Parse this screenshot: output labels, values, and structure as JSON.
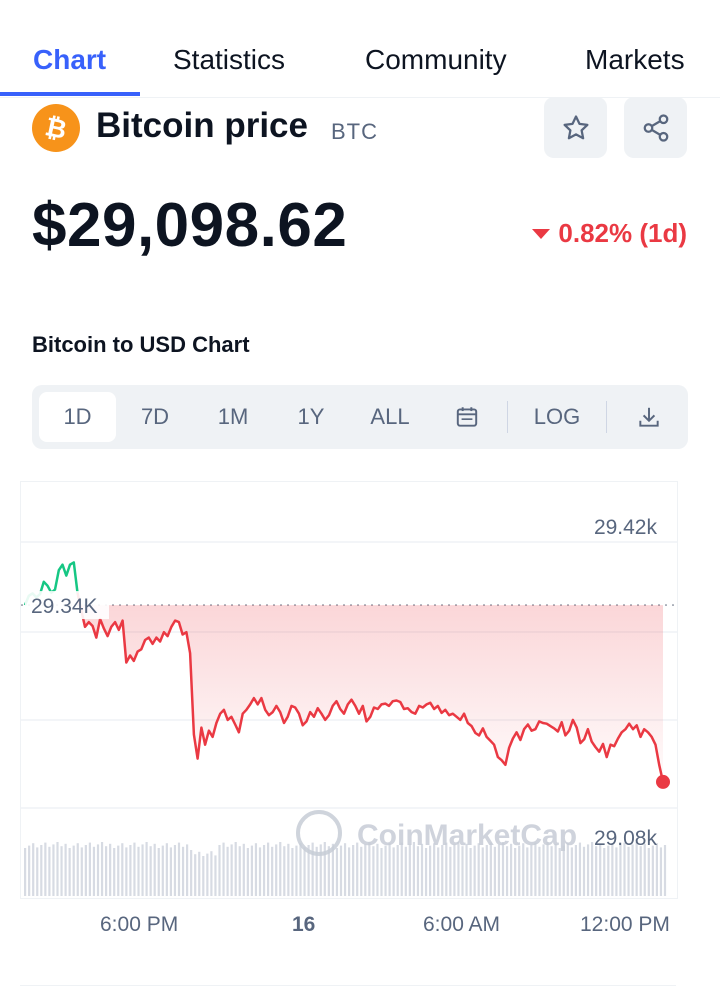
{
  "tabs": [
    {
      "label": "Chart",
      "active": true
    },
    {
      "label": "Statistics",
      "active": false
    },
    {
      "label": "Community",
      "active": false
    },
    {
      "label": "Markets",
      "active": false
    }
  ],
  "coin": {
    "name": "Bitcoin price",
    "symbol": "BTC",
    "logo_glyph": "₿",
    "logo_color": "#f7931a"
  },
  "price": "$29,098.62",
  "change": {
    "text": "0.82% (1d)",
    "direction": "down",
    "color": "#ea3943"
  },
  "chart_title": "Bitcoin to USD Chart",
  "ranges": [
    {
      "label": "1D",
      "active": true
    },
    {
      "label": "7D",
      "active": false
    },
    {
      "label": "1M",
      "active": false
    },
    {
      "label": "1Y",
      "active": false
    },
    {
      "label": "ALL",
      "active": false
    }
  ],
  "toolbar": {
    "log_label": "LOG",
    "calendar_icon": "calendar-icon",
    "download_icon": "download-icon"
  },
  "chart_data": {
    "type": "area",
    "y_axis_labels": [
      "29.42k",
      "29.08k"
    ],
    "reference_label": "29.34K",
    "reference_value": 29340,
    "ylim": [
      29050,
      29460
    ],
    "x_tick_labels": [
      "6:00 PM",
      "16",
      "6:00 AM",
      "12:00 PM"
    ],
    "watermark": "CoinMarketCap",
    "colors": {
      "up": "#16c784",
      "down": "#ea3943"
    },
    "series": [
      {
        "values": [
          29340,
          29352,
          29355,
          29350,
          29354,
          29370,
          29365,
          29356,
          29360,
          29385,
          29392,
          29378,
          29392,
          29395,
          29356,
          29333,
          29312,
          29318,
          29313,
          29298,
          29322,
          29310,
          29300,
          29312,
          29318,
          29308,
          29320,
          29266,
          29275,
          29268,
          29280,
          29283,
          29295,
          29298,
          29290,
          29298,
          29293,
          29305,
          29300,
          29312,
          29320,
          29318,
          29302,
          29305,
          29278,
          29173,
          29142,
          29182,
          29160,
          29178,
          29170,
          29188,
          29200,
          29205,
          29192,
          29196,
          29186,
          29176,
          29200,
          29205,
          29212,
          29220,
          29212,
          29220,
          29205,
          29198,
          29202,
          29210,
          29202,
          29188,
          29196,
          29210,
          29208,
          29200,
          29185,
          29190,
          29202,
          29196,
          29207,
          29200,
          29192,
          29198,
          29210,
          29216,
          29206,
          29200,
          29212,
          29218,
          29210,
          29200,
          29210,
          29190,
          29196,
          29208,
          29206,
          29212,
          29213,
          29210,
          29216,
          29217,
          29215,
          29206,
          29207,
          29202,
          29200,
          29210,
          29208,
          29212,
          29214,
          29206,
          29210,
          29201,
          29205,
          29198,
          29200,
          29196,
          29192,
          29200,
          29188,
          29184,
          29175,
          29172,
          29181,
          29170,
          29165,
          29160,
          29144,
          29140,
          29134,
          29156,
          29168,
          29176,
          29166,
          29180,
          29186,
          29178,
          29180,
          29190,
          29188,
          29187,
          29184,
          29181,
          29177,
          29189,
          29172,
          29178,
          29192,
          29182,
          29162,
          29167,
          29180,
          29164,
          29157,
          29151,
          29161,
          29144,
          29160,
          29158,
          29168,
          29176,
          29180,
          29187,
          29180,
          29185,
          29170,
          29180,
          29176,
          29170,
          29160,
          29134,
          29112
        ]
      }
    ]
  }
}
